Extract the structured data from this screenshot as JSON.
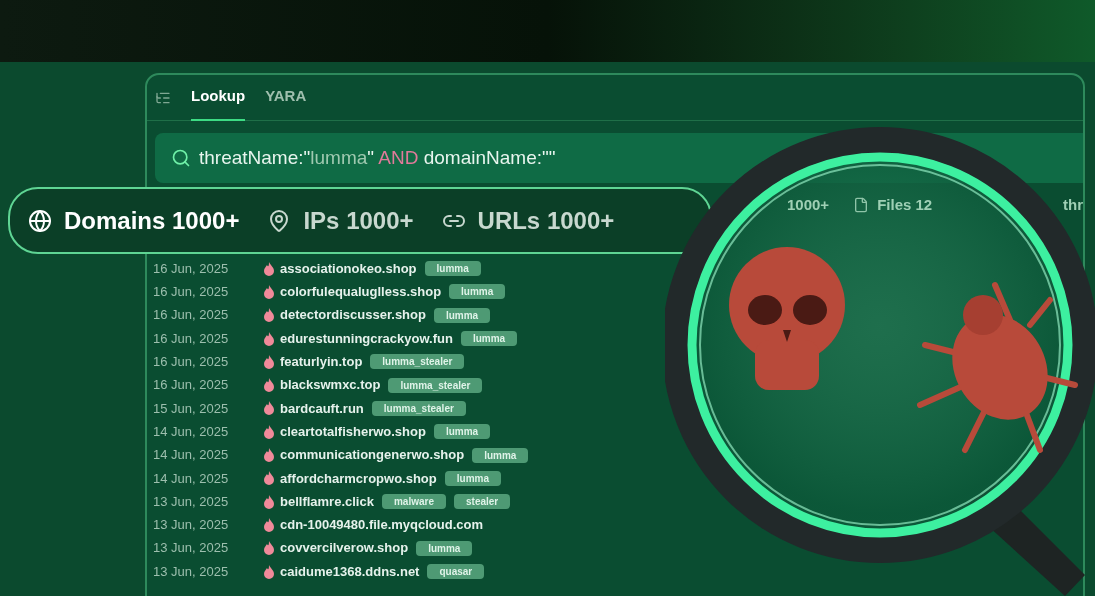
{
  "tabs": [
    {
      "label": "Lookup",
      "selected": true
    },
    {
      "label": "YARA",
      "selected": false
    }
  ],
  "query": [
    {
      "text": "threatName:\"",
      "kind": "key"
    },
    {
      "text": "lumma",
      "kind": "value"
    },
    {
      "text": "\" ",
      "kind": "key"
    },
    {
      "text": "AND",
      "kind": "operator"
    },
    {
      "text": " domainName:\"\"",
      "kind": "key"
    }
  ],
  "result_types": [
    {
      "kind": "domains",
      "label": "Domains 1000+",
      "selected": true
    },
    {
      "kind": "ips",
      "label": "IPs 1000+",
      "selected": false
    },
    {
      "kind": "urls",
      "label": "URLs 1000+",
      "selected": false
    }
  ],
  "hidden_counts": [
    {
      "kind": "plain",
      "label": "1000+"
    },
    {
      "kind": "files",
      "label": "Files 12"
    },
    {
      "kind": "plain",
      "label": "thr"
    }
  ],
  "rows": [
    {
      "date": "16 Jun, 2025",
      "domain": "associationokeo.shop",
      "tags": [
        "lumma"
      ]
    },
    {
      "date": "16 Jun, 2025",
      "domain": "colorfulequaluglless.shop",
      "tags": [
        "lumma"
      ]
    },
    {
      "date": "16 Jun, 2025",
      "domain": "detectordiscusser.shop",
      "tags": [
        "lumma"
      ]
    },
    {
      "date": "16 Jun, 2025",
      "domain": "edurestunningcrackyow.fun",
      "tags": [
        "lumma"
      ]
    },
    {
      "date": "16 Jun, 2025",
      "domain": "featurlyin.top",
      "tags": [
        "lumma_stealer"
      ]
    },
    {
      "date": "16 Jun, 2025",
      "domain": "blackswmxc.top",
      "tags": [
        "lumma_stealer"
      ]
    },
    {
      "date": "15 Jun, 2025",
      "domain": "bardcauft.run",
      "tags": [
        "lumma_stealer"
      ]
    },
    {
      "date": "14 Jun, 2025",
      "domain": "cleartotalfisherwo.shop",
      "tags": [
        "lumma"
      ]
    },
    {
      "date": "14 Jun, 2025",
      "domain": "communicationgenerwo.shop",
      "tags": [
        "lumma"
      ]
    },
    {
      "date": "14 Jun, 2025",
      "domain": "affordcharmcropwo.shop",
      "tags": [
        "lumma"
      ]
    },
    {
      "date": "13 Jun, 2025",
      "domain": "bellflamre.click",
      "tags": [
        "malware",
        "stealer"
      ]
    },
    {
      "date": "13 Jun, 2025",
      "domain": "cdn-10049480.file.myqcloud.com",
      "tags": []
    },
    {
      "date": "13 Jun, 2025",
      "domain": "covvercilverow.shop",
      "tags": [
        "lumma"
      ]
    },
    {
      "date": "13 Jun, 2025",
      "domain": "caidume1368.ddns.net",
      "tags": [
        "quasar"
      ]
    }
  ]
}
